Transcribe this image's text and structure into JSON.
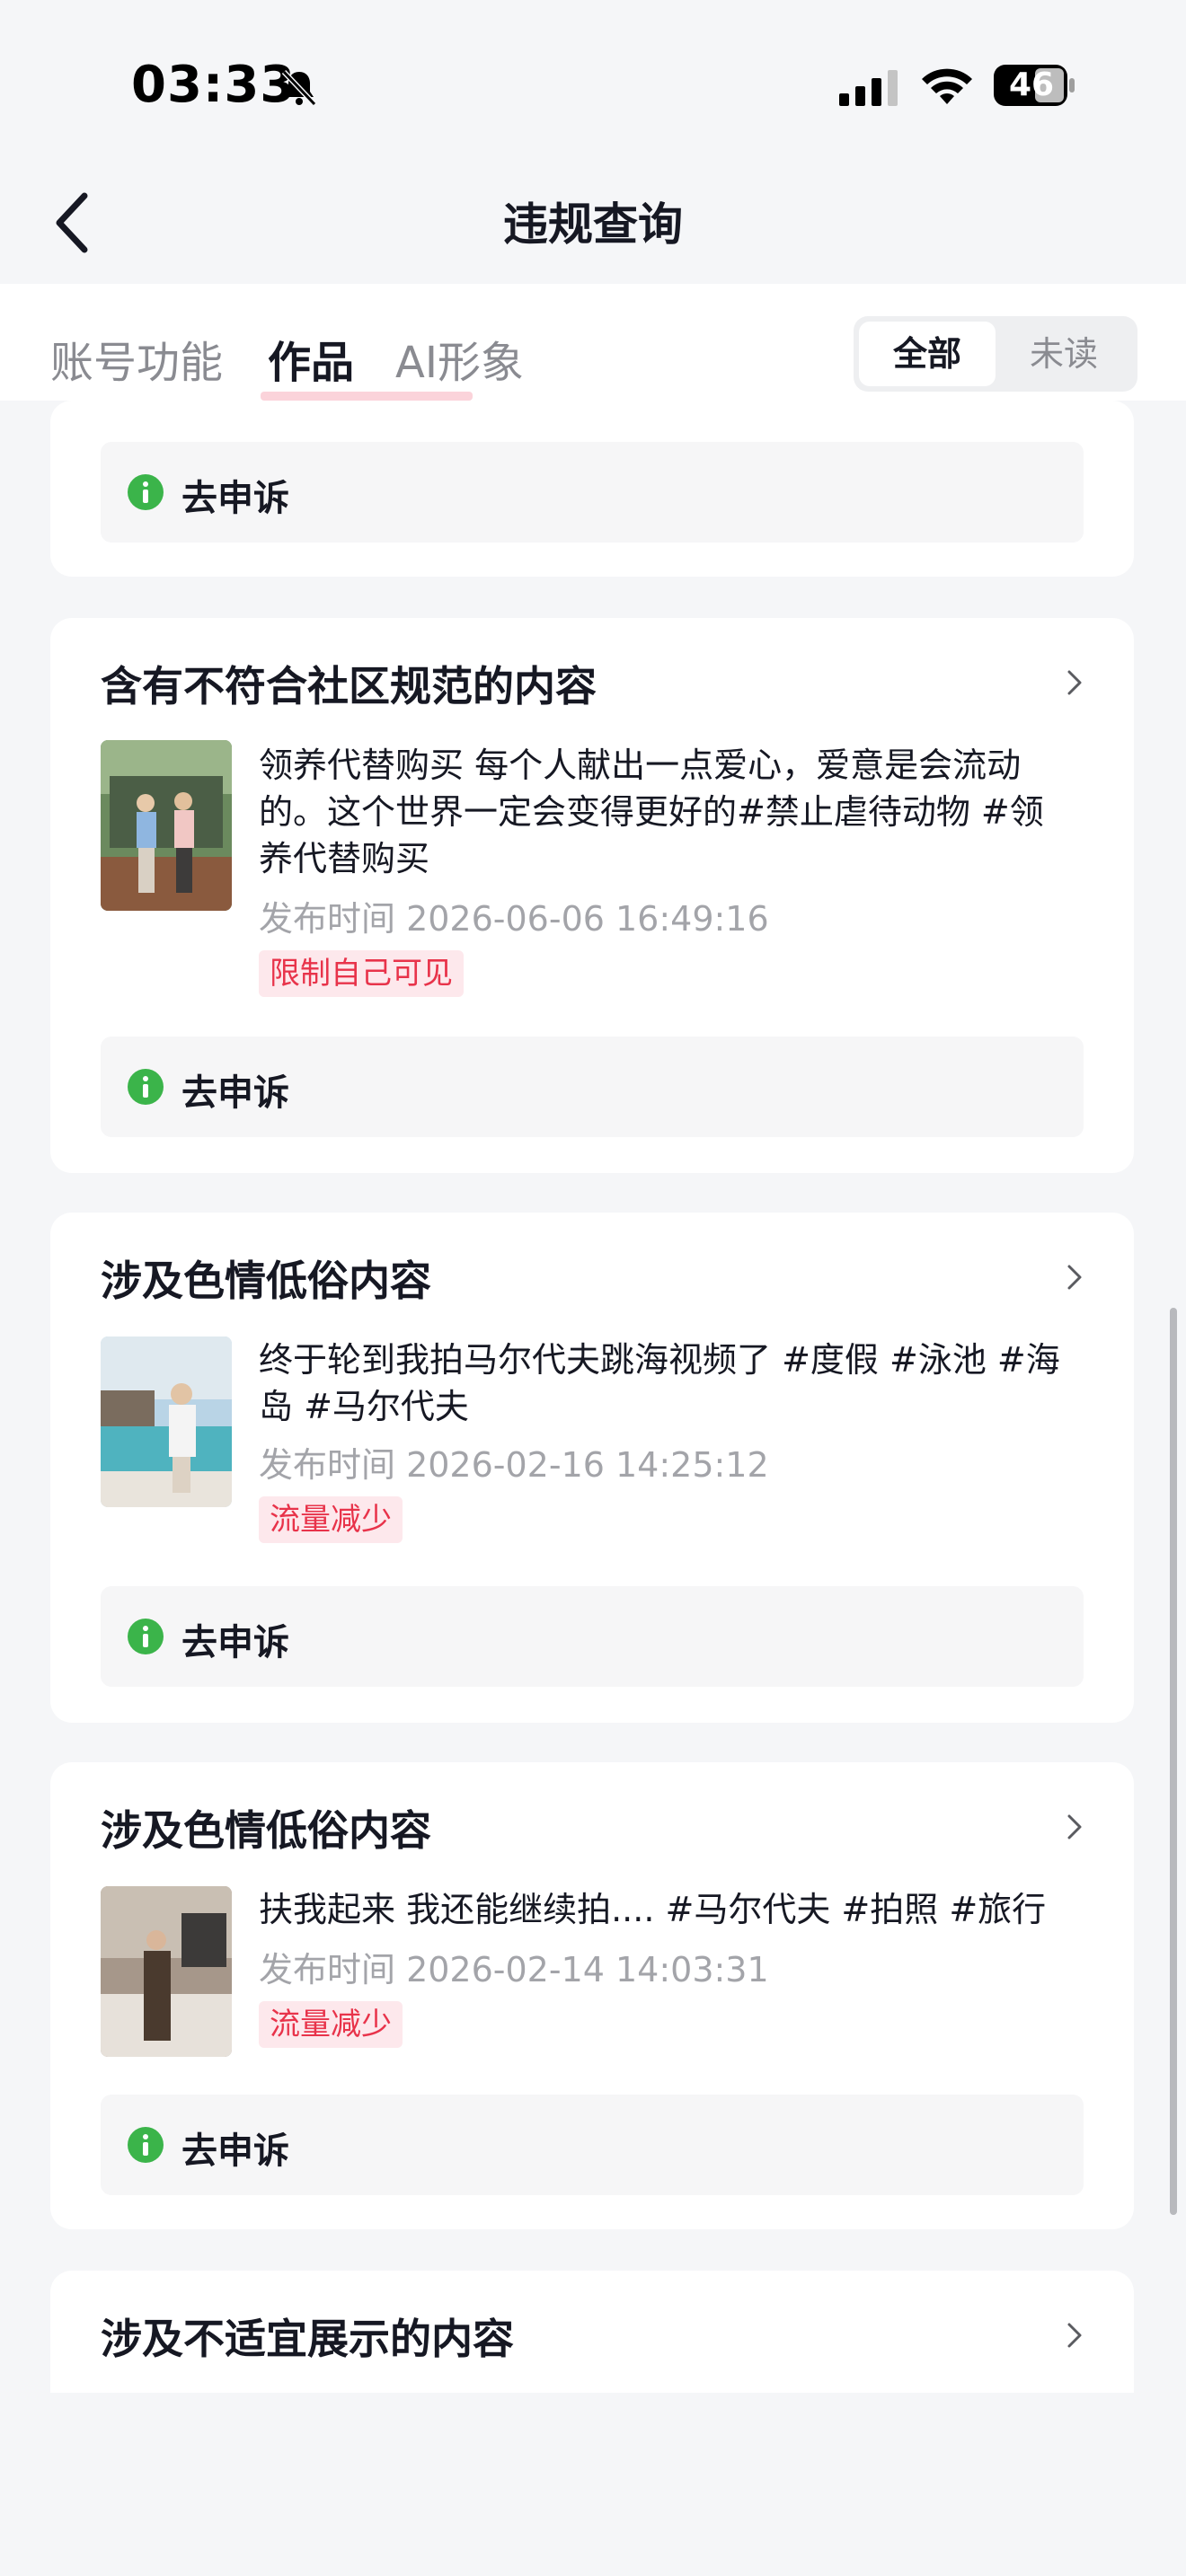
{
  "status_bar": {
    "time": "03:33",
    "battery": "46"
  },
  "nav": {
    "title": "违规查询"
  },
  "tabs": [
    {
      "label": "账号功能"
    },
    {
      "label": "作品"
    },
    {
      "label": "AI形象"
    }
  ],
  "filter": {
    "all": "全部",
    "unread": "未读"
  },
  "appeal_label": "去申诉",
  "items": [
    {
      "title": "含有不符合社区规范的内容",
      "description": "领养代替购买 每个人献出一点爱心，爱意是会流动的。这个世界一定会变得更好的#禁止虐待动物 #领养代替购买",
      "time": "发布时间 2026-06-06 16:49:16",
      "badge": "限制自己可见"
    },
    {
      "title": "涉及色情低俗内容",
      "description": "终于轮到我拍马尔代夫跳海视频了 #度假 #泳池 #海岛 #马尔代夫",
      "time": "发布时间 2026-02-16 14:25:12",
      "badge": "流量减少"
    },
    {
      "title": "涉及色情低俗内容",
      "description": "扶我起来 我还能继续拍.... #马尔代夫 #拍照 #旅行",
      "time": "发布时间 2026-02-14 14:03:31",
      "badge": "流量减少"
    },
    {
      "title": "涉及不适宜展示的内容"
    }
  ],
  "colors": {
    "background": "#f5f6f8",
    "badge_text": "#e8334a",
    "badge_bg": "#fde8ec",
    "info_icon": "#3bb44a"
  }
}
